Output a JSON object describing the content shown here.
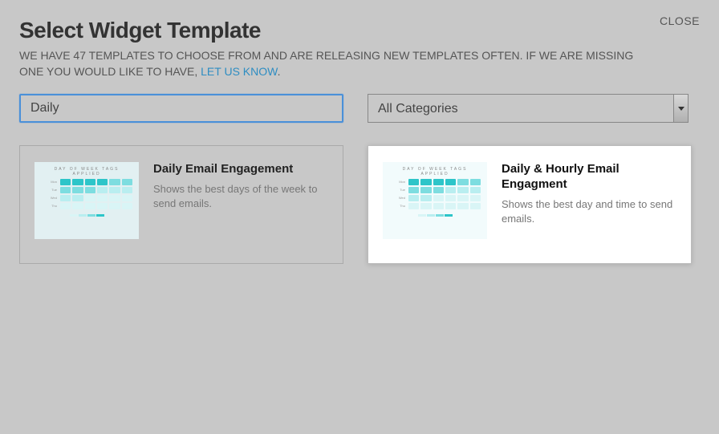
{
  "header": {
    "close": "CLOSE",
    "title": "Select Widget Template",
    "subtitle_pre": "WE HAVE 47 TEMPLATES TO CHOOSE FROM AND ARE RELEASING NEW TEMPLATES OFTEN. IF WE ARE MISSING ONE YOU WOULD LIKE TO HAVE, ",
    "subtitle_link": "LET US KNOW",
    "subtitle_post": "."
  },
  "search": {
    "value": "Daily"
  },
  "category": {
    "selected": "All Categories"
  },
  "thumb": {
    "heading": "DAY OF WEEK TAGS APPLIED",
    "row1": "Mon",
    "row2": "Tue",
    "row3": "Wed",
    "row4": "Thu"
  },
  "cards": [
    {
      "title": "Daily Email Engagement",
      "desc": "Shows the best days of the week to send emails."
    },
    {
      "title": "Daily & Hourly Email Engagment",
      "desc": "Shows the best day and time to send emails."
    }
  ]
}
